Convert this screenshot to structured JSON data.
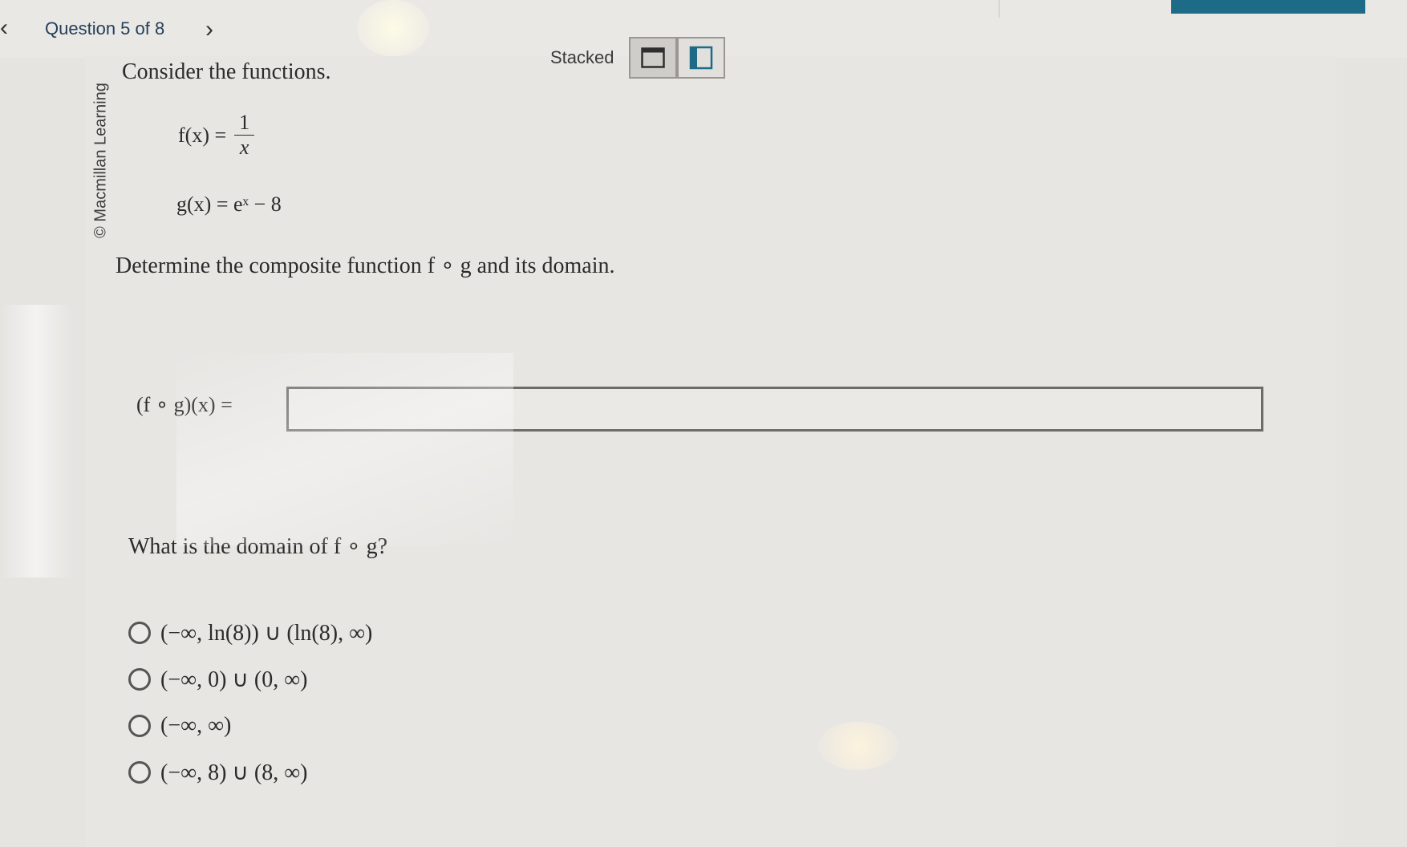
{
  "header": {
    "back_icon": "chevron-left-icon",
    "question_nav": "Question 5 of 8",
    "next_icon": "chevron-right-icon"
  },
  "view_toggle": {
    "label": "Stacked",
    "stacked_icon": "stacked-layout-icon",
    "side_by_side_icon": "side-by-side-layout-icon"
  },
  "copyright": "© Macmillan Learning",
  "question": {
    "intro": "Consider the functions.",
    "f_lhs": "f(x) =",
    "f_numerator": "1",
    "f_denominator": "x",
    "g_def": "g(x) = eˣ − 8",
    "prompt": "Determine the composite function f ∘ g and its domain."
  },
  "composite": {
    "label": "(f ∘ g)(x) =",
    "value": ""
  },
  "domain": {
    "question": "What is the domain of f ∘ g?",
    "options": [
      "(−∞, ln(8)) ∪ (ln(8), ∞)",
      "(−∞, 0) ∪ (0, ∞)",
      "(−∞, ∞)",
      "(−∞, 8) ∪ (8, ∞)"
    ]
  }
}
